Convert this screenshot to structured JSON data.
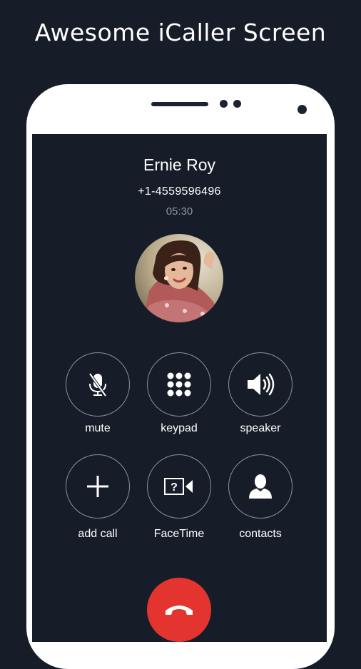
{
  "headline": "Awesome iCaller Screen",
  "call": {
    "name": "Ernie Roy",
    "number": "+1-4559596496",
    "duration": "05:30"
  },
  "controls": [
    {
      "label": "mute",
      "icon": "mic-off-icon"
    },
    {
      "label": "keypad",
      "icon": "keypad-icon"
    },
    {
      "label": "speaker",
      "icon": "speaker-icon"
    },
    {
      "label": "add call",
      "icon": "plus-icon"
    },
    {
      "label": "FaceTime",
      "icon": "facetime-icon"
    },
    {
      "label": "contacts",
      "icon": "contact-icon"
    }
  ],
  "end_call": {
    "icon": "hang-up-icon",
    "color": "#e3342f"
  },
  "colors": {
    "background": "#161d28",
    "phone_frame": "#ffffff",
    "control_border": "#8a919c",
    "timer_text": "#8f95a0"
  }
}
